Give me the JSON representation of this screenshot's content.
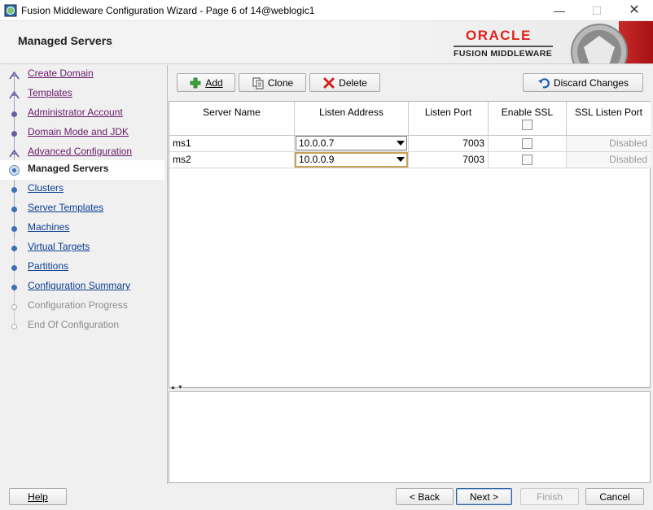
{
  "window": {
    "title": "Fusion Middleware Configuration Wizard - Page 6 of 14@weblogic1",
    "minimize_glyph": "—",
    "maximize_glyph": "☐",
    "close_glyph": "✕"
  },
  "header": {
    "page_title": "Managed Servers",
    "logo_oracle": "ORACLE",
    "logo_subtitle": "FUSION MIDDLEWARE",
    "accent_color": "#e2231a"
  },
  "nav": {
    "items": [
      {
        "label": "Create Domain",
        "state": "visited",
        "icon": "user-step-icon"
      },
      {
        "label": "Templates",
        "state": "visited",
        "icon": "user-step-icon"
      },
      {
        "label": "Administrator Account",
        "state": "visited",
        "icon": "dot-icon"
      },
      {
        "label": "Domain Mode and JDK",
        "state": "visited",
        "icon": "dot-icon"
      },
      {
        "label": "Advanced Configuration",
        "state": "visited",
        "icon": "user-step-icon"
      },
      {
        "label": "Managed Servers",
        "state": "active",
        "icon": "current-step-icon"
      },
      {
        "label": "Clusters",
        "state": "link",
        "icon": "dot-icon"
      },
      {
        "label": "Server Templates",
        "state": "link",
        "icon": "dot-icon"
      },
      {
        "label": "Machines",
        "state": "link",
        "icon": "dot-icon"
      },
      {
        "label": "Virtual Targets",
        "state": "link",
        "icon": "dot-icon"
      },
      {
        "label": "Partitions",
        "state": "link",
        "icon": "dot-icon"
      },
      {
        "label": "Configuration Summary",
        "state": "link",
        "icon": "dot-icon"
      },
      {
        "label": "Configuration Progress",
        "state": "disabled",
        "icon": "dot-icon"
      },
      {
        "label": "End Of Configuration",
        "state": "disabled",
        "icon": "dot-icon"
      }
    ]
  },
  "toolbar": {
    "add_label": "Add",
    "clone_label": "Clone",
    "delete_label": "Delete",
    "discard_label": "Discard Changes"
  },
  "table": {
    "columns": [
      "Server Name",
      "Listen Address",
      "Listen Port",
      "Enable SSL",
      "SSL Listen Port"
    ],
    "rows": [
      {
        "server_name": "ms1",
        "listen_address": "10.0.0.7",
        "listen_port": "7003",
        "enable_ssl": false,
        "ssl_listen_port": "Disabled"
      },
      {
        "server_name": "ms2",
        "listen_address": "10.0.0.9",
        "listen_port": "7003",
        "enable_ssl": false,
        "ssl_listen_port": "Disabled"
      }
    ]
  },
  "footer": {
    "help_label": "Help",
    "back_label": "< Back",
    "next_label": "Next >",
    "finish_label": "Finish",
    "cancel_label": "Cancel"
  }
}
